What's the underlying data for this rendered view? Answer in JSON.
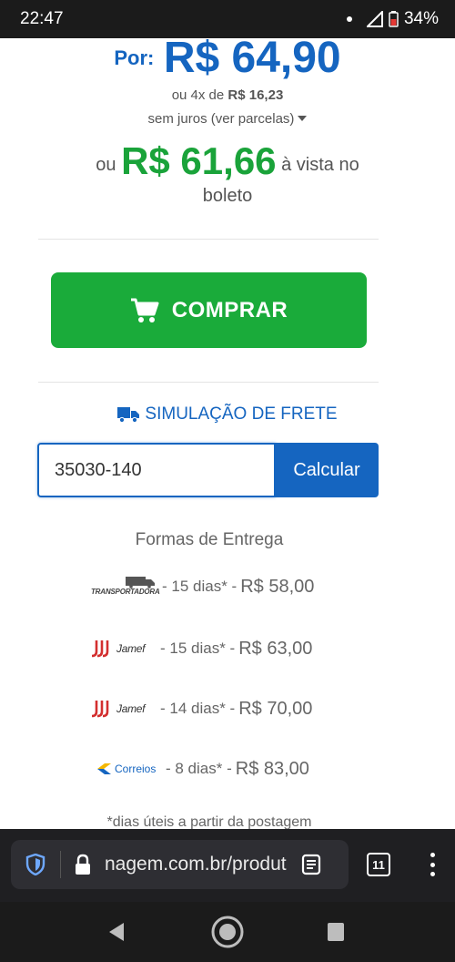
{
  "status_bar": {
    "time": "22:47",
    "battery": "34%"
  },
  "product": {
    "price_label": "Por:",
    "price": "R$ 64,90",
    "installments_prefix": "ou 4x de",
    "installment_value": "R$ 16,23",
    "no_interest_text": "sem juros (ver parcelas)",
    "boleto_prefix": "ou",
    "boleto_price": "R$ 61,66",
    "boleto_suffix_1": "à vista no",
    "boleto_suffix_2": "boleto"
  },
  "buy_button": {
    "label": "COMPRAR",
    "icon": "cart-icon",
    "color": "#1aab3a"
  },
  "shipping": {
    "title": "SIMULAÇÃO DE FRETE",
    "icon": "truck-icon",
    "cep_value": "35030-140",
    "calc_label": "Calcular",
    "delivery_title": "Formas de Entrega",
    "options": [
      {
        "carrier": "TRANSPORTADORA",
        "days": "- 15 dias* -",
        "price": "R$ 58,00"
      },
      {
        "carrier": "Jamef",
        "days": "- 15 dias* -",
        "price": "R$ 63,00"
      },
      {
        "carrier": "Jamef",
        "days": "- 14 dias* -",
        "price": "R$ 70,00"
      },
      {
        "carrier": "Correios",
        "days": "- 8 dias* -",
        "price": "R$ 83,00"
      }
    ],
    "footnote": "*dias úteis a partir da postagem"
  },
  "browser": {
    "url": "nagem.com.br/produt",
    "tab_count": "11"
  },
  "colors": {
    "primary_blue": "#1565c0",
    "green": "#1aa33a"
  }
}
